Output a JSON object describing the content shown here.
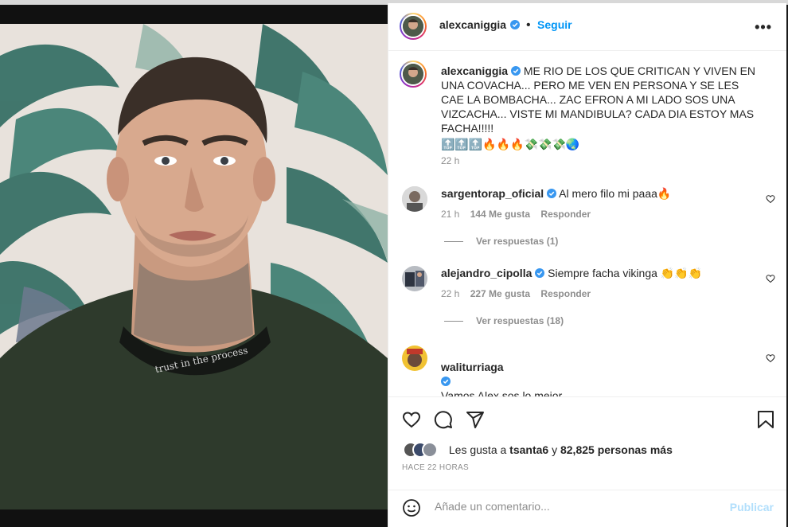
{
  "post": {
    "username": "alexcaniggia",
    "follow_label": "Seguir",
    "more_label": "•••",
    "caption_user": "alexcaniggia",
    "caption_text": "ME RIO DE LOS QUE CRITICAN Y VIVEN EN UNA COVACHA... PERO ME VEN EN PERSONA Y SE LES CAE LA BOMBACHA... ZAC EFRON A MI LADO SOS UNA VIZCACHA... VISTE MI MANDIBULA? CADA DIA ESTOY MAS FACHA!!!!!",
    "caption_emojis": "🔝🔝🔝🔥🔥🔥💸💸💸🌏",
    "caption_time": "22 h",
    "shirt_text": "trust in the process"
  },
  "comments": [
    {
      "user": "sargentorap_oficial",
      "text": "Al mero filo mi paaa🔥",
      "time": "21 h",
      "likes": "144 Me gusta",
      "reply": "Responder",
      "view_replies": "Ver respuestas (1)"
    },
    {
      "user": "alejandro_cipolla",
      "text": "Siempre facha vikinga 👏👏👏",
      "time": "22 h",
      "likes": "227 Me gusta",
      "reply": "Responder",
      "view_replies": "Ver respuestas (18)"
    },
    {
      "user": "waliturriaga",
      "text": "Vamos Alex sos lo mejor\ncon esa mandíbula pareces Ricardo Fort\nFachaaa, millo, siempre al top\nZac Efron esta de vacaciones ahora"
    }
  ],
  "likes_bar": {
    "prefix": "Les gusta a",
    "user": "tsanta6",
    "joiner": "y",
    "count": "82,825 personas más"
  },
  "timestamp": "HACE 22 HORAS",
  "add_comment": {
    "placeholder": "Añade un comentario...",
    "publish_label": "Publicar"
  },
  "colors": {
    "accent": "#0095f6",
    "publish_disabled": "#b2dffc",
    "verified": "#3897f0",
    "muted": "#8e8e8e"
  }
}
